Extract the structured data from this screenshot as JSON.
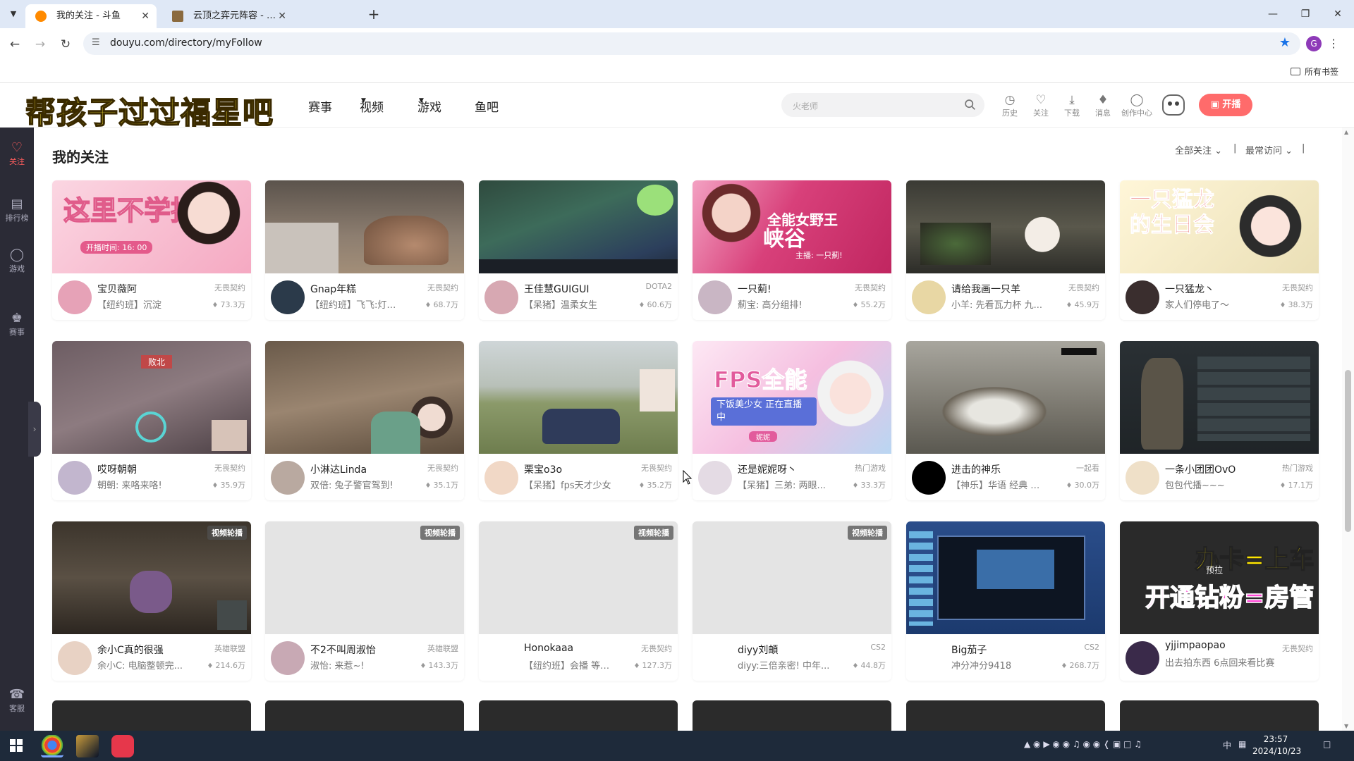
{
  "browser": {
    "tabs": [
      {
        "title": "我的关注 - 斗鱼",
        "active": true
      },
      {
        "title": "云顶之弈元阵容 - 12 版最佳元阵容",
        "active": false
      }
    ],
    "url": "douyu.com/directory/myFollow",
    "bookmarks_all": "所有书签",
    "profile_initial": "G"
  },
  "header": {
    "logo_text": "帮孩子过过福星吧",
    "nav": [
      "赛事",
      "视频",
      "游戏",
      "鱼吧"
    ],
    "search_placeholder": "火老师",
    "icons": [
      {
        "label": "历史",
        "icon": "clock-icon"
      },
      {
        "label": "关注",
        "icon": "heart-icon"
      },
      {
        "label": "下载",
        "icon": "download-icon"
      },
      {
        "label": "消息",
        "icon": "bell-icon"
      },
      {
        "label": "创作中心",
        "icon": "bulb-icon"
      }
    ],
    "live_button": "开播"
  },
  "sidebar": [
    {
      "label": "关注",
      "icon": "heart-icon",
      "active": true
    },
    {
      "label": "排行榜",
      "icon": "ranking-icon",
      "active": false
    },
    {
      "label": "游戏",
      "icon": "gamepad-icon",
      "active": false
    },
    {
      "label": "赛事",
      "icon": "trophy-icon",
      "active": false
    },
    {
      "label": "客服",
      "icon": "headset-icon",
      "active": false
    }
  ],
  "page": {
    "title": "我的关注",
    "filter_all": "全部关注",
    "filter_sort": "最常访问"
  },
  "rows": [
    [
      {
        "name": "宝贝薇阿",
        "title": "【纽约班】沉淀",
        "category": "无畏契约",
        "hot": "73.3万",
        "thumb": "#f7c3d3"
      },
      {
        "name": "Gnap年糕",
        "title": "【纽约班】飞飞:灯神...",
        "category": "无畏契约",
        "hot": "68.7万",
        "thumb": "#6e6258"
      },
      {
        "name": "王佳慧GUIGUI",
        "title": "【呆猪】温柔女生",
        "category": "DOTA2",
        "hot": "60.6万",
        "thumb": "#3c5a4a"
      },
      {
        "name": "一只薊!",
        "title": "薊宝: 高分组排!",
        "category": "无畏契约",
        "hot": "55.2万",
        "thumb": "#d8407a"
      },
      {
        "name": "请给我画一只羊",
        "title": "小羊: 先看瓦力杯 九...",
        "category": "无畏契约",
        "hot": "45.9万",
        "thumb": "#4a4a40"
      },
      {
        "name": "一只猛龙丶",
        "title": "家人们停电了～",
        "category": "无畏契约",
        "hot": "38.3万",
        "thumb": "#f0e7c8"
      }
    ],
    [
      {
        "name": "哎呀朝朝",
        "title": "朝朝: 来咯来咯!",
        "category": "无畏契约",
        "hot": "35.9万",
        "thumb": "#7d6a70"
      },
      {
        "name": "小淋达Linda",
        "title": "双倍: 兔子警官驾到!",
        "category": "无畏契约",
        "hot": "35.1万",
        "thumb": "#8a7a6a"
      },
      {
        "name": "栗宝o3o",
        "title": "【呆猪】fps天才少女",
        "category": "无畏契约",
        "hot": "35.2万",
        "thumb": "#8a9a6e"
      },
      {
        "name": "还是妮妮呀丶",
        "title": "【呆猪】三弟: 两眼...",
        "category": "热门游戏",
        "hot": "33.3万",
        "thumb": "#f2c6e6"
      },
      {
        "name": "进击的神乐",
        "title": "【神乐】华语 经典 电...",
        "category": "一起看",
        "hot": "30.0万",
        "thumb": "#8e8e88"
      },
      {
        "name": "一条小团团OvO",
        "title": "包包代播~~~",
        "category": "热门游戏",
        "hot": "17.1万",
        "thumb": "#2e3436"
      }
    ],
    [
      {
        "name": "余小C真的很强",
        "title": "余小C: 电脑整顿完...",
        "category": "英雄联盟",
        "hot": "214.6万",
        "thumb": "#4c4438",
        "tag": "视频轮播"
      },
      {
        "name": "不2不叫周淑怡",
        "title": "淑怡: 来惹~!",
        "category": "英雄联盟",
        "hot": "143.3万",
        "thumb": "#e4e4e4",
        "tag": "视频轮播"
      },
      {
        "name": "Honokaaa",
        "title": "【纽约班】会播 等病...",
        "category": "无畏契约",
        "hot": "127.3万",
        "thumb": "#e4e4e4",
        "tag": "视频轮播"
      },
      {
        "name": "diyy刘頔",
        "title": "diyy:三倍亲密! 中年...",
        "category": "CS2",
        "hot": "44.8万",
        "thumb": "#e4e4e4",
        "tag": "视频轮播"
      },
      {
        "name": "Big茄子",
        "title": "冲分冲分9418",
        "category": "CS2",
        "hot": "268.7万",
        "thumb": "#2a4d8a"
      },
      {
        "name": "yjjimpaopao",
        "title": "出去拍东西 6点回来看比赛",
        "category": "无畏契约",
        "hot": "",
        "thumb": "#2a2a2a",
        "caption1": "办卡=上车",
        "caption2": "开通钻粉=房管",
        "overlay": "预拉"
      }
    ]
  ],
  "thumb_captions": {
    "c1": "这里不学技术",
    "c1sub": "开播时间: 16: 00",
    "c4": "全能女野王",
    "c4b": "峡谷",
    "c4sub": "主播: 一只薊!",
    "c6": "一只猛龙的生日会",
    "c8": "败北",
    "c10": "FPS全能",
    "c10sub": "下饭美少女 正在直播中",
    "c10tag": "妮妮"
  },
  "taskbar": {
    "time": "23:57",
    "date": "2024/10/23",
    "ime": "中"
  }
}
